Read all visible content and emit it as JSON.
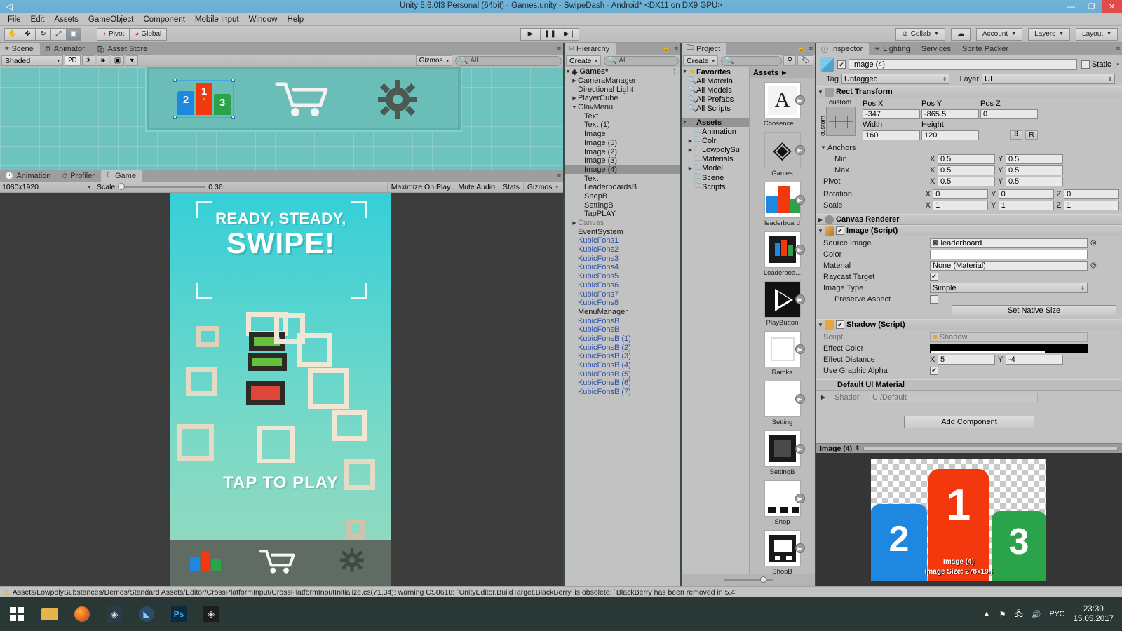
{
  "window": {
    "title": "Unity 5.6.0f3 Personal (64bit) - Games.unity - SwipeDash - Android* <DX11 on DX9 GPU>",
    "minimize": "—",
    "maximize": "❐",
    "close": "✕"
  },
  "menubar": [
    "File",
    "Edit",
    "Assets",
    "GameObject",
    "Component",
    "Mobile Input",
    "Window",
    "Help"
  ],
  "toolbar": {
    "tools": [
      "hand-tool",
      "move-tool",
      "rotate-tool",
      "scale-tool",
      "rect-tool"
    ],
    "pivot_label": "Pivot",
    "global_label": "Global",
    "play": "▶",
    "pause": "❚❚",
    "step": "▶❙",
    "collab_label": "Collab",
    "cloud_label": "☁",
    "account_label": "Account",
    "layers_label": "Layers",
    "layout_label": "Layout"
  },
  "scene": {
    "tabs": [
      {
        "label": "Scene",
        "icon": "grid-icon",
        "active": true
      },
      {
        "label": "Animator",
        "icon": "animator-icon",
        "active": false
      },
      {
        "label": "Asset Store",
        "icon": "store-icon",
        "active": false
      }
    ],
    "draw_mode": "Shaded",
    "mode_2d": "2D",
    "lighting_toggle": "☀",
    "audio_toggle": "🕪",
    "effects_toggle": "▣",
    "gizmos_label": "Gizmos",
    "search_placeholder": "All",
    "podium": {
      "first": "1",
      "second": "2",
      "third": "3"
    }
  },
  "game": {
    "tabs": [
      {
        "label": "Animation",
        "icon": "clock-icon",
        "active": false
      },
      {
        "label": "Profiler",
        "icon": "profiler-icon",
        "active": false
      },
      {
        "label": "Game",
        "icon": "gamepad-icon",
        "active": true
      }
    ],
    "aspect": "1080x1920",
    "scale_label": "Scale",
    "scale_value": "0.36:",
    "maximize_on_play": "Maximize On Play",
    "mute_audio": "Mute Audio",
    "stats": "Stats",
    "gizmos": "Gizmos",
    "screen": {
      "line1": "READY, STEADY,",
      "line2": "SWIPE!",
      "tap": "TAP TO PLAY",
      "podium": {
        "first": "1",
        "second": "2",
        "third": "3"
      }
    }
  },
  "hierarchy": {
    "tab_label": "Hierarchy",
    "create_label": "Create",
    "search_placeholder": "All",
    "scene_name": "Games*",
    "items": [
      {
        "label": "CameraManager",
        "depth": 1,
        "arrow": "▶",
        "type": "normal"
      },
      {
        "label": "Directional Light",
        "depth": 1,
        "arrow": "",
        "type": "normal"
      },
      {
        "label": "PlayerCube",
        "depth": 1,
        "arrow": "▶",
        "type": "normal"
      },
      {
        "label": "GlavMenu",
        "depth": 1,
        "arrow": "▼",
        "type": "normal"
      },
      {
        "label": "Text",
        "depth": 2,
        "arrow": "",
        "type": "normal"
      },
      {
        "label": "Text (1)",
        "depth": 2,
        "arrow": "",
        "type": "normal"
      },
      {
        "label": "Image",
        "depth": 2,
        "arrow": "",
        "type": "normal"
      },
      {
        "label": "Image (5)",
        "depth": 2,
        "arrow": "",
        "type": "normal"
      },
      {
        "label": "Image (2)",
        "depth": 2,
        "arrow": "",
        "type": "normal"
      },
      {
        "label": "Image (3)",
        "depth": 2,
        "arrow": "",
        "type": "normal"
      },
      {
        "label": "Image (4)",
        "depth": 2,
        "arrow": "",
        "type": "selected"
      },
      {
        "label": "Text",
        "depth": 2,
        "arrow": "",
        "type": "normal"
      },
      {
        "label": "LeaderboardsB",
        "depth": 2,
        "arrow": "",
        "type": "normal"
      },
      {
        "label": "ShopB",
        "depth": 2,
        "arrow": "",
        "type": "normal"
      },
      {
        "label": "SettingB",
        "depth": 2,
        "arrow": "",
        "type": "normal"
      },
      {
        "label": "TapPLAY",
        "depth": 2,
        "arrow": "",
        "type": "normal"
      },
      {
        "label": "Canvas",
        "depth": 1,
        "arrow": "▶",
        "type": "inactive"
      },
      {
        "label": "EventSystem",
        "depth": 1,
        "arrow": "",
        "type": "normal"
      },
      {
        "label": "KubicFons1",
        "depth": 1,
        "arrow": "",
        "type": "prefab"
      },
      {
        "label": "KubicFons2",
        "depth": 1,
        "arrow": "",
        "type": "prefab"
      },
      {
        "label": "KubicFons3",
        "depth": 1,
        "arrow": "",
        "type": "prefab"
      },
      {
        "label": "KubicFons4",
        "depth": 1,
        "arrow": "",
        "type": "prefab"
      },
      {
        "label": "KubicFons5",
        "depth": 1,
        "arrow": "",
        "type": "prefab"
      },
      {
        "label": "KubicFons6",
        "depth": 1,
        "arrow": "",
        "type": "prefab"
      },
      {
        "label": "KubicFons7",
        "depth": 1,
        "arrow": "",
        "type": "prefab"
      },
      {
        "label": "KubicFons8",
        "depth": 1,
        "arrow": "",
        "type": "prefab"
      },
      {
        "label": "MenuManager",
        "depth": 1,
        "arrow": "",
        "type": "normal"
      },
      {
        "label": "KubicFonsB",
        "depth": 1,
        "arrow": "",
        "type": "prefab"
      },
      {
        "label": "KubicFonsB",
        "depth": 1,
        "arrow": "",
        "type": "prefab"
      },
      {
        "label": "KubicFonsB (1)",
        "depth": 1,
        "arrow": "",
        "type": "prefab"
      },
      {
        "label": "KubicFonsB (2)",
        "depth": 1,
        "arrow": "",
        "type": "prefab"
      },
      {
        "label": "KubicFonsB (3)",
        "depth": 1,
        "arrow": "",
        "type": "prefab"
      },
      {
        "label": "KubicFonsB (4)",
        "depth": 1,
        "arrow": "",
        "type": "prefab"
      },
      {
        "label": "KubicFonsB (5)",
        "depth": 1,
        "arrow": "",
        "type": "prefab"
      },
      {
        "label": "KubicFonsB (6)",
        "depth": 1,
        "arrow": "",
        "type": "prefab"
      },
      {
        "label": "KubicFonsB (7)",
        "depth": 1,
        "arrow": "",
        "type": "prefab"
      }
    ]
  },
  "project": {
    "tab_label": "Project",
    "create_label": "Create",
    "search_placeholder": "",
    "favorites_label": "Favorites",
    "favorites": [
      "All Materia",
      "All Models",
      "All Prefabs",
      "All Scripts"
    ],
    "assets_root": "Assets",
    "folders": [
      {
        "label": "Animation",
        "arrow": ""
      },
      {
        "label": "Colr",
        "arrow": "▶"
      },
      {
        "label": "LowpolySu",
        "arrow": "▶"
      },
      {
        "label": "Materials",
        "arrow": ""
      },
      {
        "label": "Model",
        "arrow": "▶"
      },
      {
        "label": "Scene",
        "arrow": ""
      },
      {
        "label": "Scripts",
        "arrow": ""
      }
    ],
    "breadcrumb": "Assets",
    "assets": [
      {
        "label": "Chosence ...",
        "kind": "font"
      },
      {
        "label": "Games",
        "kind": "scene"
      },
      {
        "label": "leaderboard",
        "kind": "leaderboard"
      },
      {
        "label": "Leaderboa...",
        "kind": "leaderboardB"
      },
      {
        "label": "PlayButton",
        "kind": "playbutton"
      },
      {
        "label": "Ramka",
        "kind": "ramka"
      },
      {
        "label": "Setting",
        "kind": "setting"
      },
      {
        "label": "SettingB",
        "kind": "settingB"
      },
      {
        "label": "Shop",
        "kind": "shop"
      },
      {
        "label": "ShopB",
        "kind": "shopB"
      }
    ]
  },
  "inspector": {
    "tabs": [
      {
        "label": "Inspector",
        "active": true
      },
      {
        "label": "Lighting",
        "active": false
      },
      {
        "label": "Services",
        "active": false
      },
      {
        "label": "Sprite Packer",
        "active": false
      }
    ],
    "object_name": "Image (4)",
    "object_enabled": true,
    "static_label": "Static",
    "tag_label": "Tag",
    "tag_value": "Untagged",
    "layer_label": "Layer",
    "layer_value": "UI",
    "rect_transform": {
      "title": "Rect Transform",
      "anchor_preset": "custom",
      "anchor_preset_v": "custom",
      "pos_x_label": "Pos X",
      "pos_x": "-347",
      "pos_y_label": "Pos Y",
      "pos_y": "-865.5",
      "pos_z_label": "Pos Z",
      "pos_z": "0",
      "width_label": "Width",
      "width": "160",
      "height_label": "Height",
      "height": "120",
      "anchors_label": "Anchors",
      "min_label": "Min",
      "min_x": "0.5",
      "min_y": "0.5",
      "max_label": "Max",
      "max_x": "0.5",
      "max_y": "0.5",
      "pivot_label": "Pivot",
      "pivot_x": "0.5",
      "pivot_y": "0.5",
      "rotation_label": "Rotation",
      "rot_x": "0",
      "rot_y": "0",
      "rot_z": "0",
      "scale_label": "Scale",
      "scale_x": "1",
      "scale_y": "1",
      "scale_z": "1",
      "blueprint_btn": "R"
    },
    "canvas_renderer": {
      "title": "Canvas Renderer"
    },
    "image_script": {
      "title": "Image (Script)",
      "enabled": true,
      "source_image_label": "Source Image",
      "source_image_value": "leaderboard",
      "color_label": "Color",
      "color_value": "#FFFFFF",
      "material_label": "Material",
      "material_value": "None (Material)",
      "raycast_label": "Raycast Target",
      "raycast_checked": true,
      "image_type_label": "Image Type",
      "image_type_value": "Simple",
      "preserve_aspect_label": "Preserve Aspect",
      "preserve_aspect_checked": false,
      "set_native_size": "Set Native Size"
    },
    "shadow_script": {
      "title": "Shadow (Script)",
      "enabled": true,
      "script_label": "Script",
      "script_value": "Shadow",
      "effect_color_label": "Effect Color",
      "effect_color_value": "#000000",
      "effect_distance_label": "Effect Distance",
      "effect_distance_x": "5",
      "effect_distance_y": "-4",
      "use_graphic_alpha_label": "Use Graphic Alpha",
      "use_graphic_alpha_checked": true
    },
    "material": {
      "title": "Default UI Material",
      "shader_label": "Shader",
      "shader_value": "UI/Default"
    },
    "add_component": "Add Component",
    "preview": {
      "title": "Image (4)",
      "overlay_name": "Image (4)",
      "overlay_size": "Image Size: 278x194",
      "podium": {
        "first": "1",
        "second": "2",
        "third": "3"
      }
    }
  },
  "statusbar": {
    "message": "Assets/LowpolySubstances/Demos/Standard Assets/Editor/CrossPlatformInput/CrossPlatformInputInitialize.cs(71,34): warning CS0618: `UnityEditor.BuildTarget.BlackBerry' is obsolete:  `BlackBerry has been removed in 5.4'"
  },
  "taskbar": {
    "apps": [
      "folder-icon",
      "firefox-icon",
      "unity-icon",
      "kodi-icon",
      "photoshop-icon",
      "unity2-icon"
    ],
    "tray": [
      "chevron-up-icon",
      "flag-icon",
      "network-icon",
      "volume-icon"
    ],
    "language": "РУС",
    "time": "23:30",
    "date": "15.05.2017"
  },
  "colors": {
    "accent_blue": "#1e88e0",
    "accent_red": "#f2380c",
    "accent_green": "#2aa34a",
    "title_bar": "#6aaed3",
    "panel_gray": "#c2c2c2"
  }
}
